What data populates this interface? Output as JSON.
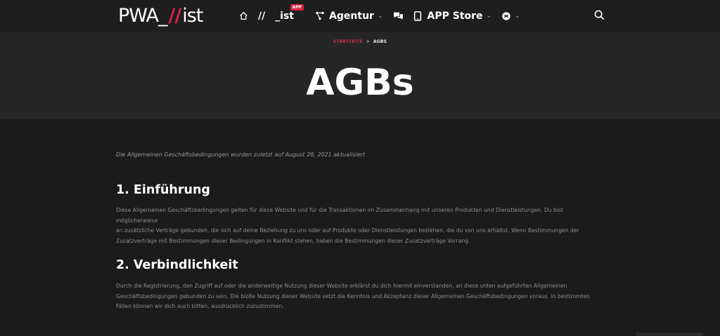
{
  "nav": {
    "logo": {
      "left": "PWA_",
      "mark": "//",
      "right": "ist"
    },
    "sep": "//",
    "ist_label": "_ist",
    "ist_badge": "APP",
    "agentur_label": "Agentur",
    "appstore_label": "APP Store"
  },
  "breadcrumb": {
    "home": "STARTSEITE",
    "separator": ">",
    "current": "AGBS"
  },
  "page_title": "AGBs",
  "content": {
    "updated": "Die Allgemeinen Geschäftsbedingungen wurden zuletzt auf August 28, 2021 aktualisiert",
    "sections": [
      {
        "heading": "1. Einführung",
        "lines": [
          "Diese Allgemeinen Geschäftsbedingungen gelten für diese Website und für die Transaktionen im Zusammenhang mit unseren Produkten und Dienstleistungen. Du bist möglicherweise",
          "an zusätzliche Verträge gebunden, die sich auf deine Beziehung zu uns oder auf Produkte oder Dienstleistungen beziehen, die du von uns erhältst. Wenn Bestimmungen der",
          "Zusatzverträge mit Bestimmungen dieser Bedingungen in Konflikt stehen, haben die Bestimmungen dieser Zusatzverträge Vorrang."
        ]
      },
      {
        "heading": "2. Verbindlichkeit",
        "lines": [
          "Durch die Registrierung, den Zugriff auf oder die anderweitige Nutzung dieser Website erklärst du dich hiermit einverstanden, an diese unten aufgeführten Allgemeinen",
          "Geschäftsbedingungen gebunden zu sein. Die bloße Nutzung dieser Website setzt die Kenntnis und Akzeptanz dieser Allgemeinen Geschäftsbedingungen voraus. In bestimmten",
          "Fällen können wir dich auch bitten, ausdrücklich zuzustimmen."
        ]
      }
    ]
  },
  "colors": {
    "accent": "#d7263d",
    "background": "#1b1b1b",
    "hero": "#262626"
  }
}
